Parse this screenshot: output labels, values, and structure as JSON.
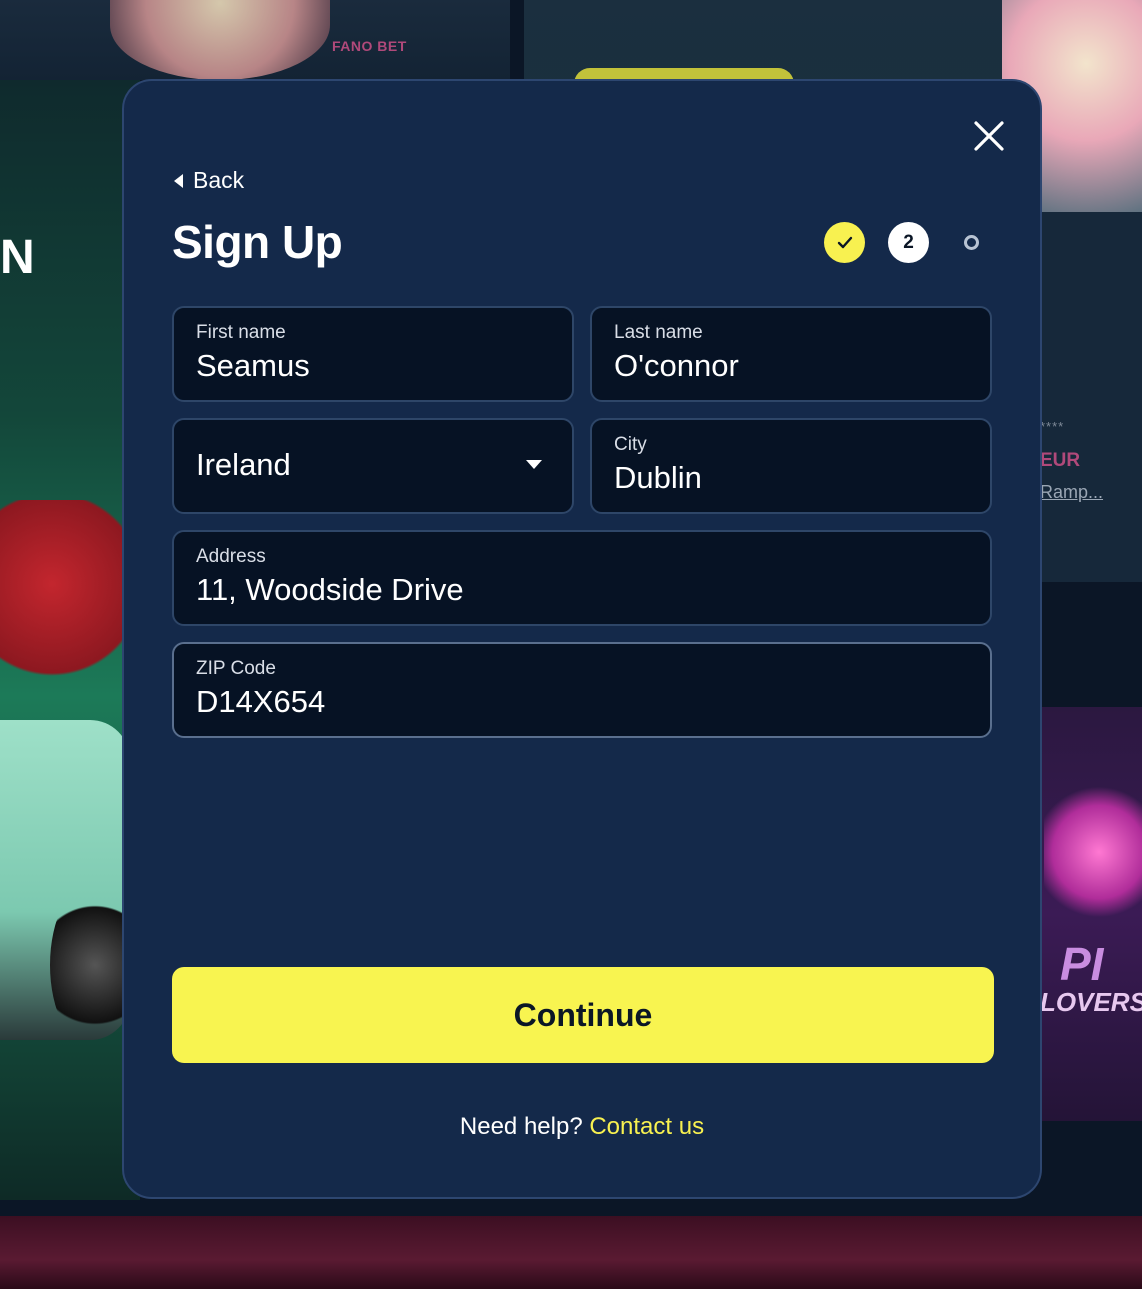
{
  "background": {
    "brand_text": "FANO BET",
    "hero_letter": "N",
    "side_stars": "****",
    "side_currency": "EUR",
    "side_link": "Ramp...",
    "game_title_top": "PI",
    "game_title_bottom": "LOVERS"
  },
  "modal": {
    "back_label": "Back",
    "title": "Sign Up",
    "steps": {
      "current_number": "2"
    },
    "fields": {
      "first_name": {
        "label": "First name",
        "value": "Seamus"
      },
      "last_name": {
        "label": "Last name",
        "value": "O'connor"
      },
      "country": {
        "value": "Ireland"
      },
      "city": {
        "label": "City",
        "value": "Dublin"
      },
      "address": {
        "label": "Address",
        "value": "11, Woodside Drive"
      },
      "zip": {
        "label": "ZIP Code",
        "value": "D14X654"
      }
    },
    "continue_label": "Continue",
    "help_text": "Need help?",
    "contact_label": "Contact us"
  },
  "colors": {
    "accent": "#f8f150",
    "modal_bg": "#14294a",
    "field_bg": "#061224"
  }
}
